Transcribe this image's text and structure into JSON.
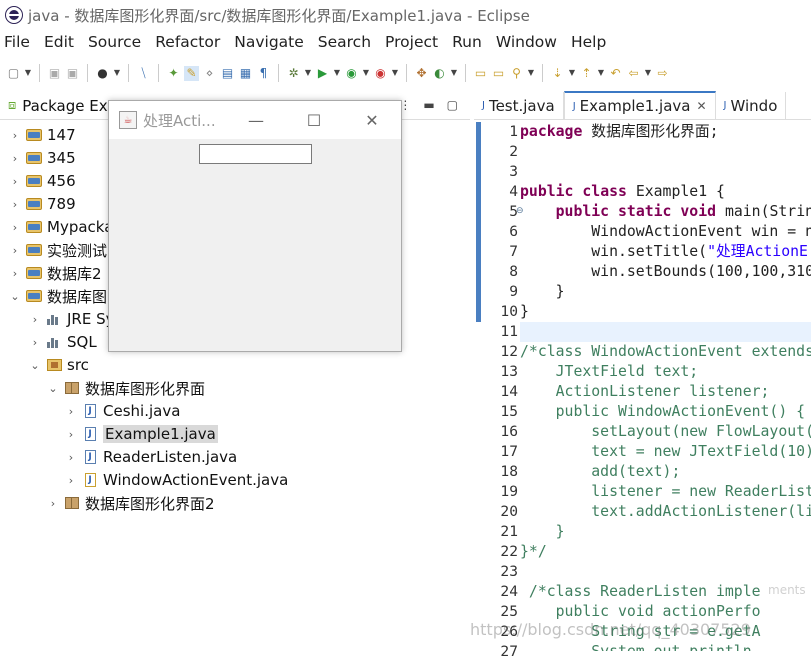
{
  "window": {
    "title": "java - 数据库图形化界面/src/数据库图形化界面/Example1.java - Eclipse"
  },
  "menu": [
    "File",
    "Edit",
    "Source",
    "Refactor",
    "Navigate",
    "Search",
    "Project",
    "Run",
    "Window",
    "Help"
  ],
  "package_explorer": {
    "title": "Package Exp",
    "items": [
      {
        "label": "147",
        "kind": "project"
      },
      {
        "label": "345",
        "kind": "project"
      },
      {
        "label": "456",
        "kind": "project"
      },
      {
        "label": "789",
        "kind": "project"
      },
      {
        "label": "Mypacka",
        "kind": "project"
      },
      {
        "label": "实验测试",
        "kind": "project"
      },
      {
        "label": "数据库2",
        "kind": "project"
      },
      {
        "label": "数据库图",
        "kind": "project"
      },
      {
        "label": "JRE Sy",
        "kind": "library"
      },
      {
        "label": "SQL",
        "kind": "library"
      },
      {
        "label": "src",
        "kind": "source"
      },
      {
        "label": "数据库图形化界面",
        "kind": "package"
      },
      {
        "label": "Ceshi.java",
        "kind": "file"
      },
      {
        "label": "Example1.java",
        "kind": "file"
      },
      {
        "label": "ReaderListen.java",
        "kind": "file"
      },
      {
        "label": "WindowActionEvent.java",
        "kind": "file"
      },
      {
        "label": "数据库图形化界面2",
        "kind": "package"
      }
    ]
  },
  "floating_window": {
    "title": "处理Acti...",
    "min": "—",
    "max": "☐",
    "close": "✕"
  },
  "editor": {
    "tabs": [
      "Test.java",
      "Example1.java",
      "Windo"
    ],
    "line_numbers": [
      "1",
      "2",
      "3",
      "4",
      "5",
      "6",
      "7",
      "8",
      "9",
      "10",
      "11",
      "12",
      "13",
      "14",
      "15",
      "16",
      "17",
      "18",
      "19",
      "20",
      "21",
      "22",
      "23",
      "24",
      "25",
      "26",
      "27"
    ]
  },
  "watermark": "https://blog.csdn.net/qq_40307529",
  "watermark_small": "ments"
}
